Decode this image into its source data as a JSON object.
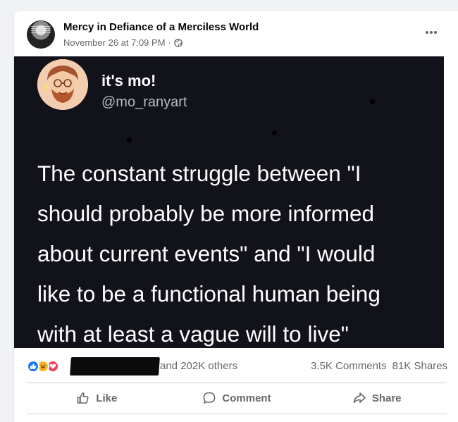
{
  "post": {
    "page_name": "Mercy in Defiance of a Merciless World",
    "timestamp": "November 26 at 7:09 PM",
    "separator": "·",
    "audience_icon": "globe-icon",
    "more_icon": "more-options-icon"
  },
  "image": {
    "tweet_name": "it's mo!",
    "tweet_handle": "@mo_ranyart",
    "tweet_text": "The constant struggle between \"I\nshould probably be more informed\nabout current events\" and \"I would\nlike to be a functional human being\nwith at least a vague will to live\""
  },
  "reactions": {
    "icons": [
      "like-reaction-icon",
      "haha-reaction-icon",
      "love-reaction-icon"
    ],
    "summary": "and 202K others",
    "comments": "3.5K Comments",
    "shares": "81K Shares"
  },
  "actions": {
    "like_label": "Like",
    "comment_label": "Comment",
    "share_label": "Share"
  },
  "colors": {
    "accent": "#1877f2",
    "secondary_text": "#65676b",
    "image_background": "#12121b"
  }
}
